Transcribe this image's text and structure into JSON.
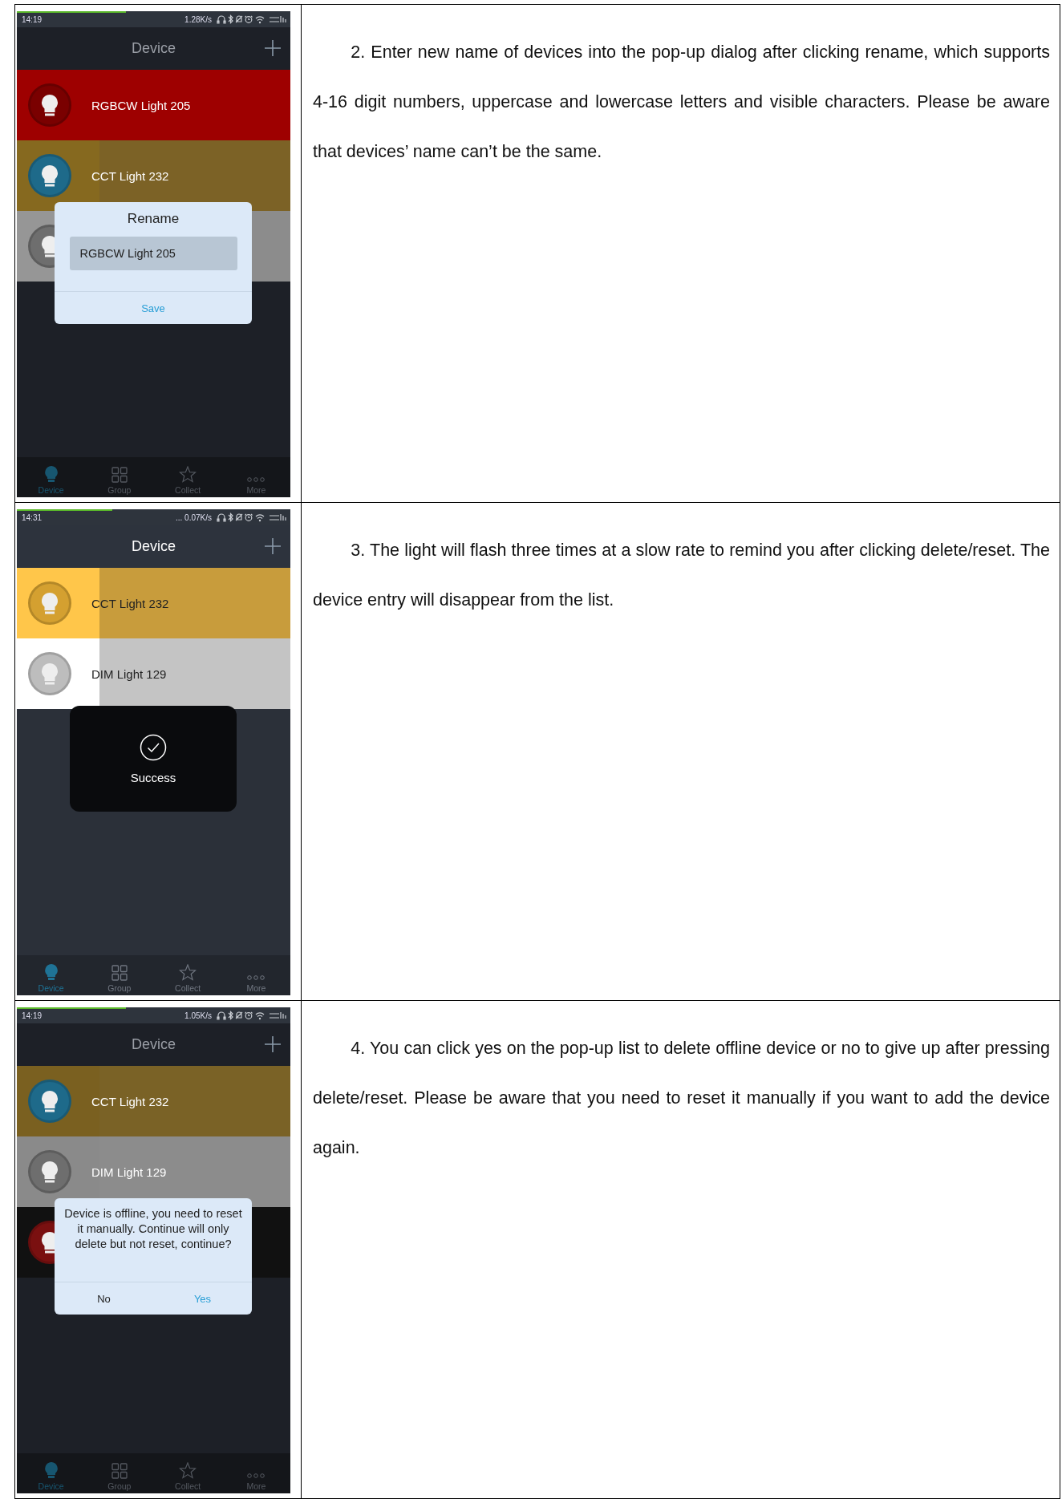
{
  "steps": [
    {
      "text": "2. Enter new name of devices into the pop-up dialog after clicking rename, which supports 4-16 digit numbers, uppercase and lowercase letters and visible characters. Please be aware that devices’ name can’t be the same.",
      "phone": {
        "modal": true,
        "status": {
          "time": "14:19",
          "speed": "1.28K/s",
          "level": 0.4
        },
        "title": "Device",
        "rows": [
          {
            "name": "RGBCW Light 205",
            "color": "#9e0000",
            "side": {
              "color": "#9e0000"
            },
            "icon": {
              "color": "#7a0000"
            }
          },
          {
            "name": "CCT Light 232",
            "color": "#7c6226",
            "side": {
              "color": "#86691f"
            },
            "icon": {
              "color": "#1e6a8a"
            }
          },
          {
            "color": "#8c8c8c",
            "side": {
              "color": "#969696"
            },
            "icon": {
              "color": "#6e6e6e"
            }
          }
        ],
        "overlay": {
          "kind": "rename",
          "title": "Rename",
          "value": "RGBCW Light 205",
          "buttons": [
            {
              "label": "Save",
              "primary": true
            }
          ]
        },
        "tabs": [
          {
            "label": "Device",
            "selected": true
          },
          {
            "label": "Group",
            "selected": false
          },
          {
            "label": "Collect",
            "selected": false
          },
          {
            "label": "More",
            "selected": false
          }
        ]
      }
    },
    {
      "text": "3. The light will flash three times at a slow rate to remind you after clicking delete/reset. The device entry will disappear from the list.",
      "phone": {
        "modal": false,
        "status": {
          "time": "14:31",
          "speed": "... 0.07K/s",
          "level": 0.35
        },
        "title": "Device",
        "rows": [
          {
            "name": "CCT Light 232",
            "color": "#c89c3c",
            "side": {
              "color": "#ffc64a"
            },
            "icon": {
              "color": "#d4a030"
            }
          },
          {
            "name": "DIM Light 129",
            "color": "#c4c4c4",
            "side": {
              "color": "#ffffff"
            },
            "icon": {
              "color": "#bdbdbd"
            }
          }
        ],
        "overlay": {
          "kind": "toast",
          "text": "Success"
        },
        "tabs": [
          {
            "label": "Device",
            "selected": true
          },
          {
            "label": "Group",
            "selected": false
          },
          {
            "label": "Collect",
            "selected": false
          },
          {
            "label": "More",
            "selected": false
          }
        ]
      }
    },
    {
      "text": "4. You can click yes on the pop-up list to delete offline device or no to give up after pressing delete/reset. Please be aware that you need to reset it manually if you want to add the device again.",
      "phone": {
        "modal": true,
        "status": {
          "time": "14:19",
          "speed": "1.05K/s",
          "level": 0.4
        },
        "title": "Device",
        "rows": [
          {
            "name": "CCT Light 232",
            "color": "#7a6226",
            "side": {
              "color": "#7a6020"
            },
            "icon": {
              "color": "#1e6a8a"
            }
          },
          {
            "name": "DIM Light 129",
            "color": "#8c8c8c",
            "side": {
              "color": "#8a8a8a"
            },
            "icon": {
              "color": "#6e6e6e"
            }
          },
          {
            "color": "#111111",
            "side": {
              "color": "#111111"
            },
            "icon": {
              "color": "#7a1010"
            }
          }
        ],
        "overlay": {
          "kind": "confirm",
          "message": "Device is offline, you need to reset it manually. Continue will only delete but not reset, continue?",
          "buttons": [
            {
              "label": "No",
              "primary": false
            },
            {
              "label": "Yes",
              "primary": true
            }
          ]
        },
        "tabs": [
          {
            "label": "Device",
            "selected": true
          },
          {
            "label": "Group",
            "selected": false
          },
          {
            "label": "Collect",
            "selected": false
          },
          {
            "label": "More",
            "selected": false
          }
        ]
      }
    }
  ]
}
